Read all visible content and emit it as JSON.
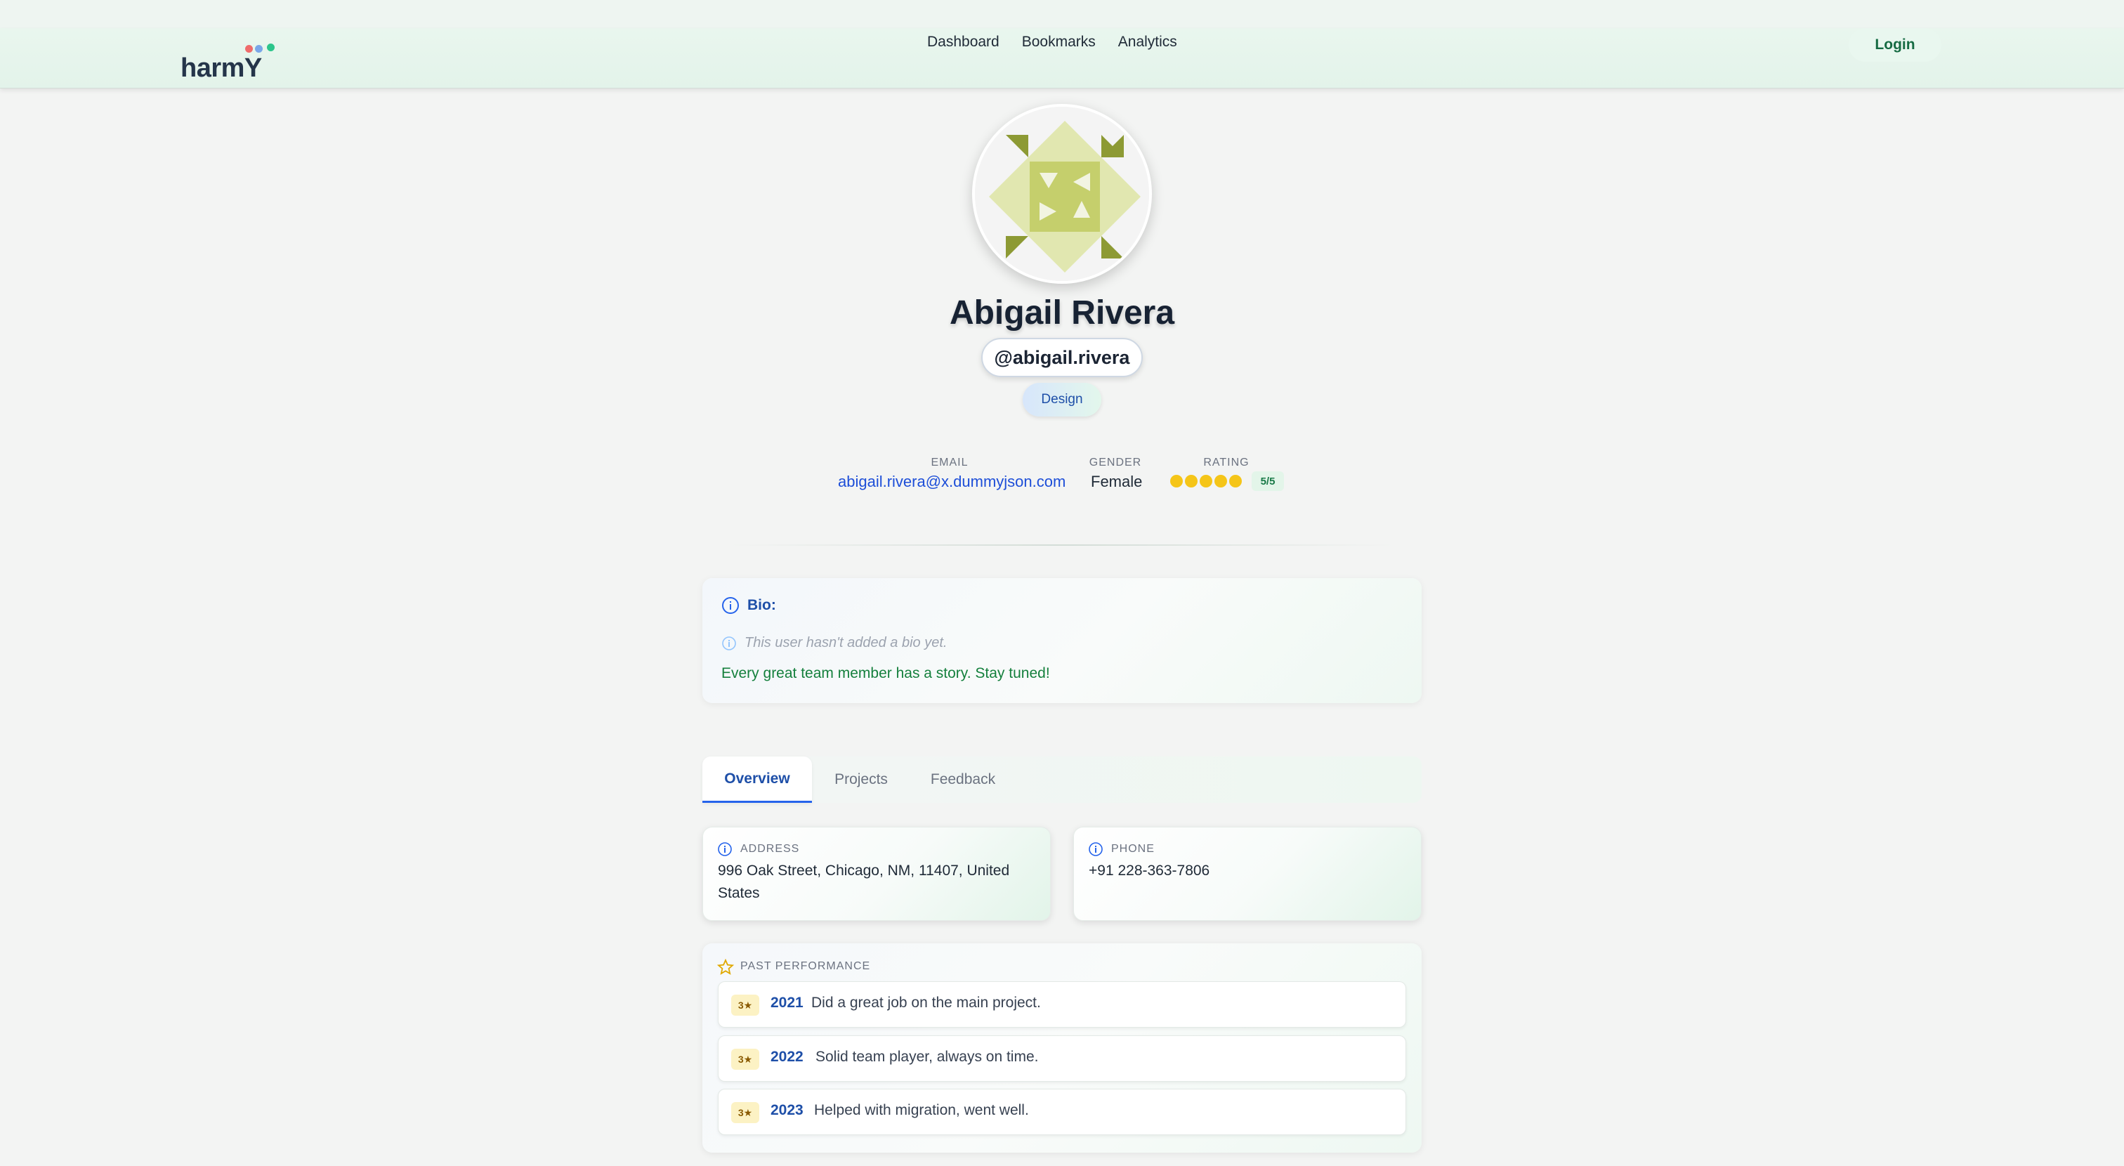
{
  "brand": {
    "name": "harmY",
    "dot_colors": [
      "#ef6b6b",
      "#7aa6e8",
      "#2cc58b"
    ]
  },
  "nav": {
    "links": [
      "Dashboard",
      "Bookmarks",
      "Analytics"
    ],
    "login": "Login"
  },
  "profile": {
    "name": "Abigail Rivera",
    "handle": "@abigail.rivera",
    "department": "Design",
    "email_label": "EMAIL",
    "email": "abigail.rivera@x.dummyjson.com",
    "gender_label": "GENDER",
    "gender": "Female",
    "rating_label": "RATING",
    "rating_value": 5,
    "rating_max": 5,
    "rating_text": "5/5"
  },
  "bio": {
    "title": "Bio:",
    "empty_text": "This user hasn't added a bio yet.",
    "tagline": "Every great team member has a story. Stay tuned!"
  },
  "tabs": [
    {
      "label": "Overview",
      "active": true
    },
    {
      "label": "Projects",
      "active": false
    },
    {
      "label": "Feedback",
      "active": false
    }
  ],
  "overview": {
    "address_label": "ADDRESS",
    "address": "996 Oak Street, Chicago, NM, 11407, United States",
    "phone_label": "PHONE",
    "phone": "+91 228-363-7806"
  },
  "performance": {
    "label": "PAST PERFORMANCE",
    "rows": [
      {
        "rating": "3★",
        "year": "2021",
        "text": "Did a great job on the main project."
      },
      {
        "rating": "3★",
        "year": "2022",
        "text": "Solid team player, always on time."
      },
      {
        "rating": "3★",
        "year": "2023",
        "text": "Helped with migration, went well."
      }
    ]
  },
  "colors": {
    "accent": "#1e4fa8",
    "success": "#15803d",
    "star": "#f5c518",
    "avatar_dark": "#8d9a34",
    "avatar_mid": "#c5cf6c",
    "avatar_light": "#e1e7b0"
  }
}
